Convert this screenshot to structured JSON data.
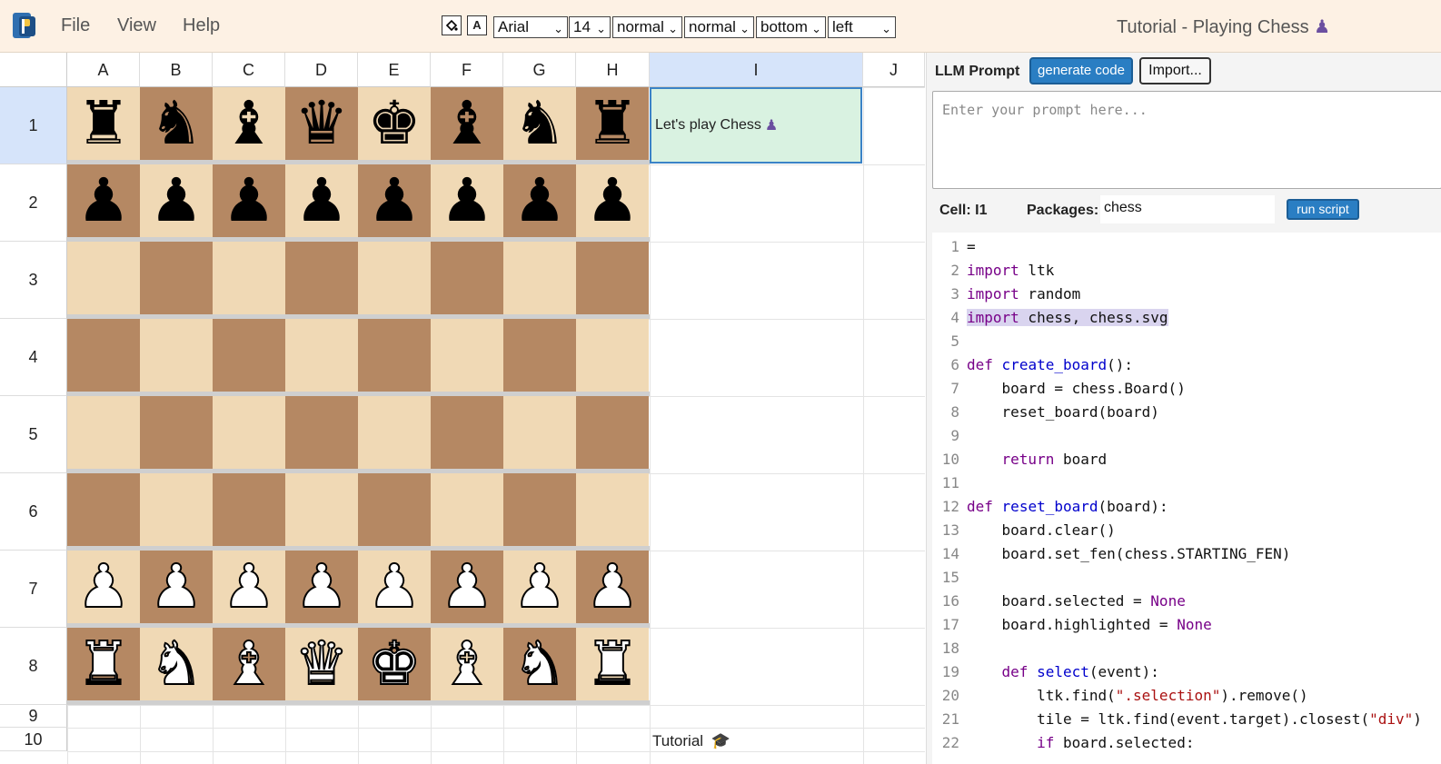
{
  "menu": {
    "file": "File",
    "view": "View",
    "help": "Help"
  },
  "toolbar": {
    "fill_icon": "paint-bucket-icon",
    "text_icon": "A",
    "font": "Arial",
    "size": "14",
    "weight": "normal",
    "style": "normal",
    "valign": "bottom",
    "halign": "left"
  },
  "app_title": "Tutorial - Playing Chess",
  "sheet": {
    "columns": [
      "A",
      "B",
      "C",
      "D",
      "E",
      "F",
      "G",
      "H",
      "I",
      "J"
    ],
    "rows": [
      "1",
      "2",
      "3",
      "4",
      "5",
      "6",
      "7",
      "8",
      "9",
      "10"
    ],
    "selected_column": "I",
    "selected_row": "1",
    "cell_i1": "Let's play Chess",
    "cell_i10": "Tutorial",
    "board": [
      [
        "♜",
        "♞",
        "♝",
        "♛",
        "♚",
        "♝",
        "♞",
        "♜"
      ],
      [
        "♟",
        "♟",
        "♟",
        "♟",
        "♟",
        "♟",
        "♟",
        "♟"
      ],
      [
        "",
        "",
        "",
        "",
        "",
        "",
        "",
        ""
      ],
      [
        "",
        "",
        "",
        "",
        "",
        "",
        "",
        ""
      ],
      [
        "",
        "",
        "",
        "",
        "",
        "",
        "",
        ""
      ],
      [
        "",
        "",
        "",
        "",
        "",
        "",
        "",
        ""
      ],
      [
        "♟",
        "♟",
        "♟",
        "♟",
        "♟",
        "♟",
        "♟",
        "♟"
      ],
      [
        "♜",
        "♞",
        "♝",
        "♛",
        "♚",
        "♝",
        "♞",
        "♜"
      ]
    ],
    "colors": {
      "light_square": "#f0d9b5",
      "dark_square": "#b58863",
      "selection": "#3b83c7",
      "selected_cell_fill": "#d9f2e1"
    }
  },
  "panel": {
    "llm_label": "LLM Prompt",
    "generate_button": "generate code",
    "import_button": "Import...",
    "prompt_placeholder": "Enter your prompt here...",
    "cell_label": "Cell: I1",
    "packages_label": "Packages:",
    "packages_value": "chess",
    "run_button": "run script",
    "code_lines": [
      "=",
      "import ltk",
      "import random",
      "import chess, chess.svg",
      "",
      "def create_board():",
      "    board = chess.Board()",
      "    reset_board(board)",
      "",
      "    return board",
      "",
      "def reset_board(board):",
      "    board.clear()",
      "    board.set_fen(chess.STARTING_FEN)",
      "",
      "    board.selected = None",
      "    board.highlighted = None",
      "",
      "    def select(event):",
      "        ltk.find(\".selection\").remove()",
      "        tile = ltk.find(event.target).closest(\"div\")",
      "        if board.selected:"
    ]
  }
}
